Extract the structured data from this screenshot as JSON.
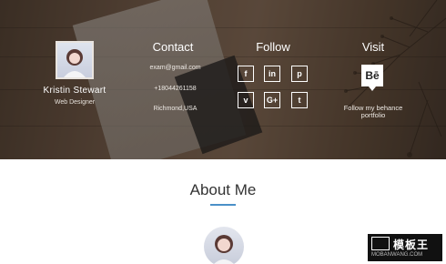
{
  "profile": {
    "name": "Kristin Stewart",
    "role": "Web Designer"
  },
  "contact": {
    "title": "Contact",
    "email": "exam@gmail.com",
    "phone": "+18044261158",
    "location": "Richmond,USA"
  },
  "follow": {
    "title": "Follow",
    "icons": [
      {
        "name": "facebook-icon",
        "glyph": "f"
      },
      {
        "name": "linkedin-icon",
        "glyph": "in"
      },
      {
        "name": "pinterest-icon",
        "glyph": "p"
      },
      {
        "name": "vimeo-icon",
        "glyph": "v"
      },
      {
        "name": "google-plus-icon",
        "glyph": "G+"
      },
      {
        "name": "tumblr-icon",
        "glyph": "t"
      }
    ]
  },
  "visit": {
    "title": "Visit",
    "behance_glyph": "Bē",
    "line1": "Follow my behance",
    "line2": "portfolio"
  },
  "about": {
    "title": "About Me"
  },
  "watermark": {
    "cn": "模板王",
    "url": "MOBANWANG.COM"
  },
  "colors": {
    "accent": "#4a90c8"
  }
}
